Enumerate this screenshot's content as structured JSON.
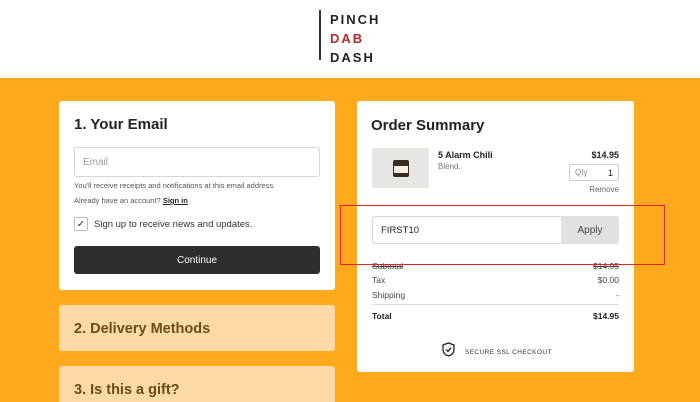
{
  "brand": {
    "line1": "PINCH",
    "line2": "DAB",
    "line3": "DASH"
  },
  "email_section": {
    "title": "1.  Your Email",
    "email_placeholder": "Email",
    "hint": "You'll receive receipts and notifications at this email address.",
    "account_prompt": "Already have an account?",
    "sign_in_label": "Sign in",
    "newsletter_checked": true,
    "newsletter_label": "Sign up to receive news and updates.",
    "continue_label": "Continue"
  },
  "delivery_section": {
    "title": "2.  Delivery Methods"
  },
  "gift_section": {
    "title": "3.  Is this a gift?"
  },
  "order_summary": {
    "title": "Order Summary",
    "item": {
      "name": "5 Alarm Chili",
      "subtitle": "Blend.",
      "price": "$14.95",
      "qty_label": "Qty",
      "qty_value": "1",
      "remove_label": "Remove"
    },
    "discount_code": "FIRST10",
    "apply_label": "Apply",
    "subtotal_label": "Subtotal",
    "subtotal_value": "$14.95",
    "tax_label": "Tax",
    "tax_value": "$0.00",
    "shipping_label": "Shipping",
    "shipping_value": "-",
    "total_label": "Total",
    "total_value": "$14.95",
    "secure_label": "SECURE SSL CHECKOUT"
  },
  "colors": {
    "background": "#ffaa1d",
    "collapsed_section": "#fdd9a6",
    "button_dark": "#2e2e2e",
    "brand_red": "#b42a2a",
    "highlight_box": "#e82020"
  }
}
